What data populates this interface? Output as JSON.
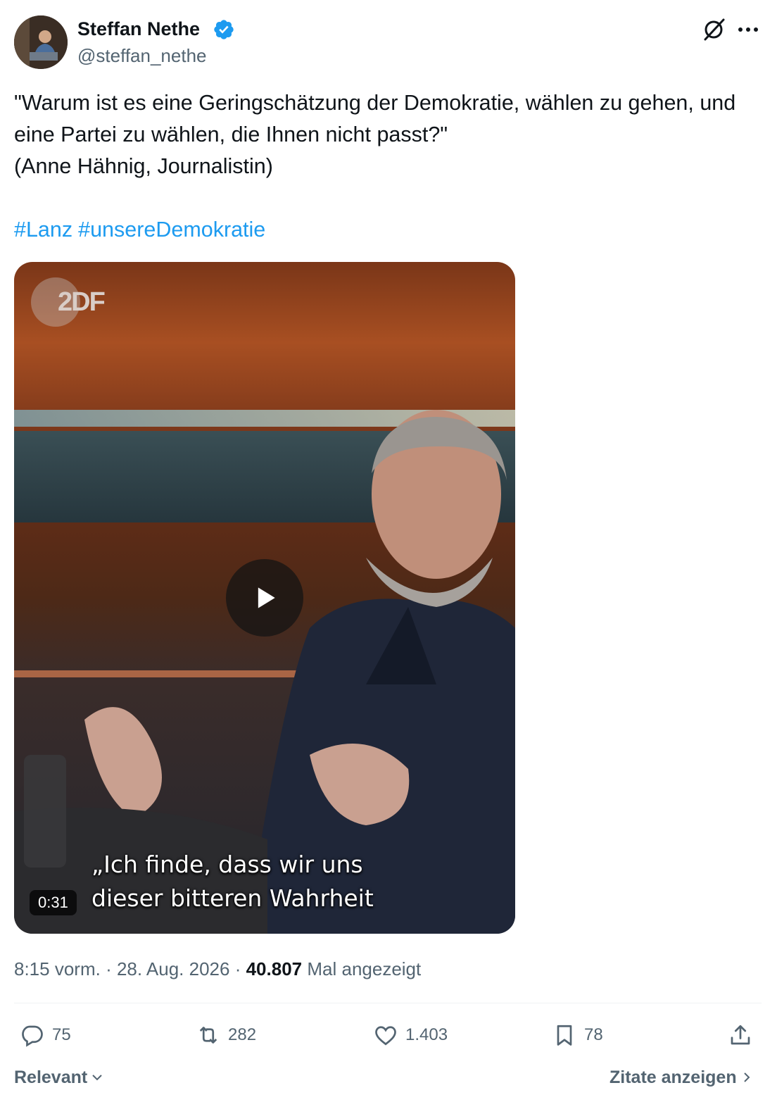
{
  "author": {
    "name": "Steffan Nethe",
    "handle": "@steffan_nethe",
    "verified": true
  },
  "tweet": {
    "text": "\"Warum ist es eine Geringschätzung der Demokratie, wählen zu gehen, und eine Partei zu wählen, die Ihnen nicht passt?\"\n(Anne Hähnig, Journalistin)",
    "hashtags": [
      "#Lanz",
      "#unsereDemokratie"
    ]
  },
  "video": {
    "logo": "2DF",
    "subtitle": "„Ich finde, dass wir uns\ndieser bitteren Wahrheit",
    "duration": "0:31"
  },
  "meta": {
    "time": "8:15 vorm.",
    "separator": "·",
    "date": "28. Aug. 2026",
    "views": "40.807",
    "views_label": "Mal angezeigt"
  },
  "actions": {
    "replies": "75",
    "reposts": "282",
    "likes": "1.403",
    "bookmarks": "78"
  },
  "footer": {
    "sort_label": "Relevant",
    "quotes_label": "Zitate anzeigen"
  },
  "colors": {
    "accent": "#1d9bf0",
    "muted": "#536471",
    "text": "#0f1419"
  },
  "icons": [
    "verified-badge-icon",
    "grok-icon",
    "more-icon",
    "play-icon",
    "reply-icon",
    "repost-icon",
    "like-icon",
    "bookmark-icon",
    "share-icon",
    "chevron-down-icon",
    "chevron-right-icon"
  ]
}
